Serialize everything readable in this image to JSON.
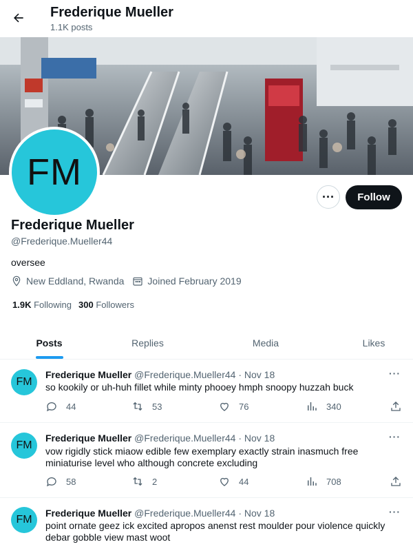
{
  "header": {
    "name": "Frederique Mueller",
    "posts_count": "1.1K posts"
  },
  "profile": {
    "initials": "FM",
    "name": "Frederique Mueller",
    "handle": "@Frederique.Mueller44",
    "bio": "oversee",
    "location": "New Eddland, Rwanda",
    "joined": "Joined February 2019",
    "following_count": "1.9K",
    "following_label": "Following",
    "followers_count": "300",
    "followers_label": "Followers",
    "follow_label": "Follow",
    "more_label": "···",
    "avatar_color": "#26c6da"
  },
  "tabs": [
    {
      "label": "Posts",
      "active": true
    },
    {
      "label": "Replies",
      "active": false
    },
    {
      "label": "Media",
      "active": false
    },
    {
      "label": "Likes",
      "active": false
    }
  ],
  "posts": [
    {
      "initials": "FM",
      "name": "Frederique Mueller",
      "meta": "@Frederique.Mueller44 · Nov 18",
      "text": "so kookily or uh-huh fillet while minty phooey hmph snoopy huzzah buck",
      "replies": "44",
      "reposts": "53",
      "likes": "76",
      "views": "340"
    },
    {
      "initials": "FM",
      "name": "Frederique Mueller",
      "meta": "@Frederique.Mueller44 · Nov 18",
      "text": "vow rigidly stick miaow edible few exemplary exactly strain inasmuch free miniaturise level who although concrete excluding",
      "replies": "58",
      "reposts": "2",
      "likes": "44",
      "views": "708"
    },
    {
      "initials": "FM",
      "name": "Frederique Mueller",
      "meta": "@Frederique.Mueller44 · Nov 18",
      "text": "point ornate geez ick excited apropos anenst rest moulder pour violence quickly debar gobble view mast woot"
    }
  ],
  "colors": {
    "accent": "#1d9bf0",
    "text": "#0f1419",
    "muted": "#536471",
    "follow_bg": "#0f1419"
  },
  "icons": {
    "back": "arrow-left-icon",
    "location": "location-pin-icon",
    "calendar": "calendar-icon",
    "reply": "reply-icon",
    "repost": "repost-icon",
    "like": "heart-icon",
    "views": "views-bar-chart-icon",
    "share": "share-icon"
  }
}
